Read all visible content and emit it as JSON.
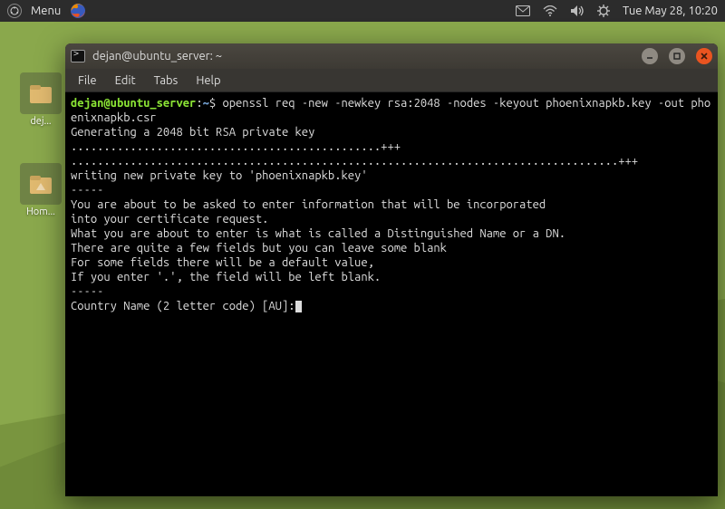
{
  "panel": {
    "menu_label": "Menu",
    "clock": "Tue May 28, 10:20"
  },
  "desktop": {
    "icon1_label": "dej...",
    "icon2_label": "Hom..."
  },
  "terminal": {
    "title": "dejan@ubuntu_server: ~",
    "menu": {
      "file": "File",
      "edit": "Edit",
      "tabs": "Tabs",
      "help": "Help"
    },
    "prompt": {
      "user_host": "dejan@ubuntu_server",
      "colon": ":",
      "path": "~",
      "sigil": "$ "
    },
    "command": "openssl req -new -newkey rsa:2048 -nodes -keyout phoenixnapkb.key -out phoenixnapkb.csr",
    "lines": {
      "l0": "Generating a 2048 bit RSA private key",
      "l1": "...............................................+++",
      "l2": "...................................................................................+++",
      "l3": "writing new private key to 'phoenixnapkb.key'",
      "l4": "-----",
      "l5": "You are about to be asked to enter information that will be incorporated",
      "l6": "into your certificate request.",
      "l7": "What you are about to enter is what is called a Distinguished Name or a DN.",
      "l8": "There are quite a few fields but you can leave some blank",
      "l9": "For some fields there will be a default value,",
      "l10": "If you enter '.', the field will be left blank.",
      "l11": "-----",
      "l12": "Country Name (2 letter code) [AU]:"
    }
  }
}
